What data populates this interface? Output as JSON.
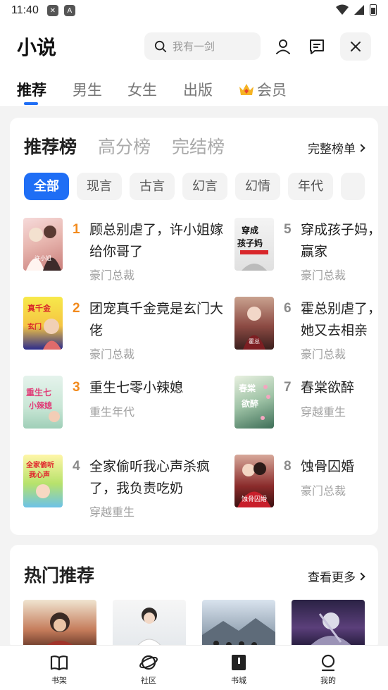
{
  "status": {
    "time": "11:40"
  },
  "header": {
    "title": "小说",
    "search_placeholder": "我有一剑"
  },
  "channels": [
    "推荐",
    "男生",
    "女生",
    "出版",
    "会员"
  ],
  "ranking": {
    "tabs": [
      "推荐榜",
      "高分榜",
      "完结榜"
    ],
    "more": "完整榜单",
    "chips": [
      "全部",
      "现言",
      "古言",
      "幻言",
      "幻情",
      "年代"
    ],
    "books": [
      {
        "rank": "1",
        "title": "顾总别虐了，许小姐嫁给你哥了",
        "tag": "豪门总裁"
      },
      {
        "rank": "2",
        "title": "团宠真千金竟是玄门大佬",
        "tag": "豪门总裁"
      },
      {
        "rank": "3",
        "title": "重生七零小辣媳",
        "tag": "重生年代"
      },
      {
        "rank": "4",
        "title": "全家偷听我心声杀疯了，我负责吃奶",
        "tag": "穿越重生"
      },
      {
        "rank": "5",
        "title": "穿成孩子妈，成赢家",
        "tag": "豪门总裁"
      },
      {
        "rank": "6",
        "title": "霍总别虐了，姐她又去相亲",
        "tag": "豪门总裁"
      },
      {
        "rank": "7",
        "title": "春棠欲醉",
        "tag": "穿越重生"
      },
      {
        "rank": "8",
        "title": "蚀骨囚婚",
        "tag": "豪门总裁"
      }
    ]
  },
  "hot": {
    "title": "热门推荐",
    "more": "查看更多"
  },
  "nav": [
    "书架",
    "社区",
    "书城",
    "我的"
  ],
  "colors": {
    "accent": "#1f6ef5",
    "rank_top": "#f28a1c"
  }
}
